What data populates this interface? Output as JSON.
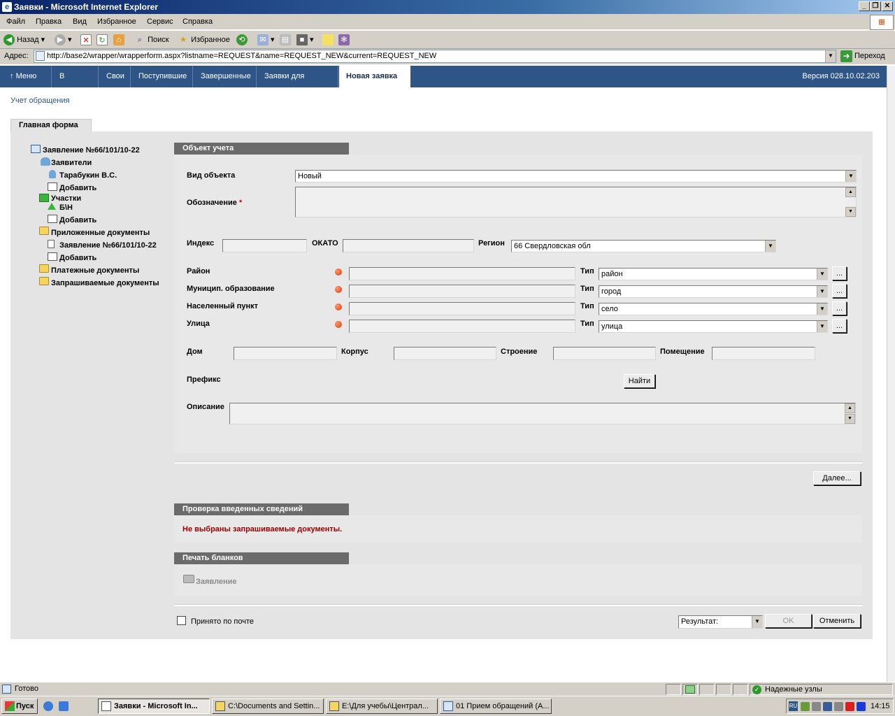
{
  "window": {
    "title": "Заявки - Microsoft Internet Explorer"
  },
  "menu": [
    "Файл",
    "Правка",
    "Вид",
    "Избранное",
    "Сервис",
    "Справка"
  ],
  "toolbar": {
    "back": "Назад",
    "search": "Поиск",
    "favorites": "Избранное"
  },
  "address": {
    "label": "Адрес:",
    "url": "http://base2/wrapper/wrapperform.aspx?listname=REQUEST&name=REQUEST_NEW&current=REQUEST_NEW",
    "go": "Переход"
  },
  "nav": {
    "tabs": [
      "Меню",
      "В работе",
      "Свои",
      "Поступившие",
      "Завершенные",
      "Заявки для приема",
      "Новая заявка"
    ],
    "version": "Версия 028.10.02.203"
  },
  "page": {
    "title": "Учет обращения",
    "main_tab": "Главная форма"
  },
  "tree": {
    "root": "Заявление №66/101/10-22",
    "applicants": "Заявители",
    "applicant1": "Тарабукин В.С.",
    "add1": "Добавить",
    "plots": "Участки",
    "plot1": "Б\\Н",
    "add2": "Добавить",
    "attached": "Приложенные документы",
    "attached1": "Заявление №66/101/10-22",
    "add3": "Добавить",
    "payment": "Платежные документы",
    "requested": "Запрашиваемые документы"
  },
  "form": {
    "section": "Объект учета",
    "object_type_label": "Вид объекта",
    "object_type_value": "Новый",
    "designation_label": "Обозначение",
    "required_mark": "*",
    "index_label": "Индекс",
    "okato_label": "ОКАТО",
    "region_label": "Регион",
    "region_value": "66 Свердловская обл",
    "rows": [
      {
        "label": "Район",
        "type_label": "Тип",
        "type_value": "район"
      },
      {
        "label": "Муницип. образование",
        "type_label": "Тип",
        "type_value": "город"
      },
      {
        "label": "Населенный пункт",
        "type_label": "Тип",
        "type_value": "село"
      },
      {
        "label": "Улица",
        "type_label": "Тип",
        "type_value": "улица"
      }
    ],
    "ellipsis": "...",
    "house_label": "Дом",
    "building_label": "Корпус",
    "structure_label": "Строение",
    "room_label": "Помещение",
    "prefix_label": "Префикс",
    "find_button": "Найти",
    "description_label": "Описание"
  },
  "next_button": "Далее...",
  "check": {
    "title": "Проверка введенных сведений",
    "message": "Не выбраны запрашиваемые документы."
  },
  "print": {
    "title": "Печать бланков",
    "item": "Заявление"
  },
  "footer": {
    "mail_checkbox": "Принято по почте",
    "result_select": "Результат:",
    "ok": "OK",
    "cancel": "Отменить"
  },
  "status": {
    "text": "Готово",
    "zone": "Надежные узлы"
  },
  "taskbar": {
    "start": "Пуск",
    "items": [
      "Заявки - Microsoft In...",
      "C:\\Documents and Settin...",
      "E:\\Для учебы\\Централ...",
      "01 Прием обращений (А..."
    ],
    "lang": "RU",
    "clock": "14:15"
  },
  "colors": {
    "nav_bg": "#2e5585",
    "section_head": "#6b6b6b",
    "error_text": "#a00000",
    "panel_bg": "#e4e4e4"
  }
}
